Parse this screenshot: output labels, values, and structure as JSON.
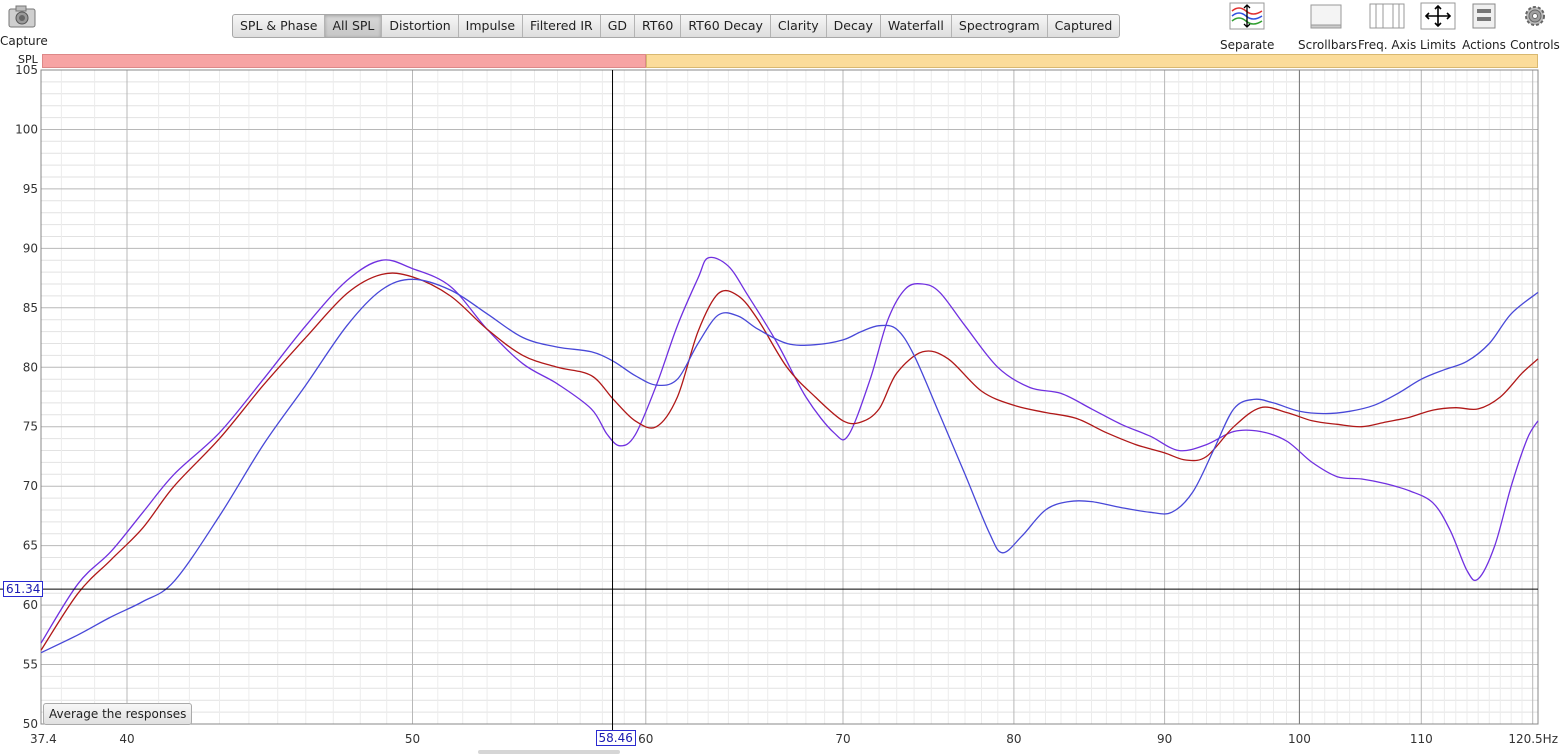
{
  "toolbar": {
    "capture_label": "Capture",
    "tabs": [
      {
        "label": "SPL & Phase",
        "active": false
      },
      {
        "label": "All SPL",
        "active": true
      },
      {
        "label": "Distortion",
        "active": false
      },
      {
        "label": "Impulse",
        "active": false
      },
      {
        "label": "Filtered IR",
        "active": false
      },
      {
        "label": "GD",
        "active": false
      },
      {
        "label": "RT60",
        "active": false
      },
      {
        "label": "RT60 Decay",
        "active": false
      },
      {
        "label": "Clarity",
        "active": false
      },
      {
        "label": "Decay",
        "active": false
      },
      {
        "label": "Waterfall",
        "active": false
      },
      {
        "label": "Spectrogram",
        "active": false
      },
      {
        "label": "Captured",
        "active": false
      }
    ],
    "tools": {
      "separate": "Separate",
      "scrollbars": "Scrollbars",
      "freq_axis": "Freq. Axis",
      "limits": "Limits",
      "actions": "Actions",
      "controls": "Controls"
    }
  },
  "legend_bar": {
    "label": "SPL",
    "colors": [
      "#f7a4a4",
      "#fbdc9a"
    ]
  },
  "cursor": {
    "x_value": "58.46",
    "y_value": "61.34"
  },
  "buttons": {
    "average": "Average the responses"
  },
  "chart_data": {
    "type": "line",
    "xscale": "log",
    "xlim": [
      37.4,
      120.5
    ],
    "ylim": [
      50,
      105
    ],
    "grid": true,
    "x_ticks": [
      "37.4",
      "40",
      "50",
      "60",
      "70",
      "80",
      "90",
      "100",
      "110",
      "120.5Hz"
    ],
    "x_tick_values": [
      37.4,
      40,
      50,
      60,
      70,
      80,
      90,
      100,
      110,
      120.5
    ],
    "y_ticks": [
      50,
      55,
      60,
      65,
      70,
      75,
      80,
      85,
      90,
      95,
      100,
      105
    ],
    "series": [
      {
        "color": "#7030e0",
        "points": [
          [
            37.4,
            56.8
          ],
          [
            38.5,
            61.8
          ],
          [
            39.5,
            64.5
          ],
          [
            40.5,
            67.8
          ],
          [
            41.5,
            71
          ],
          [
            43,
            74.5
          ],
          [
            44.5,
            79
          ],
          [
            46,
            83.5
          ],
          [
            47.5,
            87.3
          ],
          [
            48.8,
            89
          ],
          [
            50,
            88.3
          ],
          [
            51.5,
            86.8
          ],
          [
            53,
            83.2
          ],
          [
            54.5,
            80.3
          ],
          [
            56,
            78.6
          ],
          [
            57.5,
            76.5
          ],
          [
            58.2,
            74.4
          ],
          [
            58.8,
            73.4
          ],
          [
            59.5,
            74.3
          ],
          [
            60.5,
            78.5
          ],
          [
            61.5,
            83.5
          ],
          [
            62.5,
            87.5
          ],
          [
            63,
            89.2
          ],
          [
            64,
            88.5
          ],
          [
            65,
            86
          ],
          [
            66.5,
            82
          ],
          [
            68,
            77.5
          ],
          [
            69.5,
            74.5
          ],
          [
            70.3,
            74.3
          ],
          [
            71.5,
            79
          ],
          [
            72.5,
            84
          ],
          [
            73.5,
            86.6
          ],
          [
            74.5,
            87
          ],
          [
            75.5,
            86.3
          ],
          [
            77,
            83.5
          ],
          [
            79,
            80
          ],
          [
            81,
            78.3
          ],
          [
            83,
            77.8
          ],
          [
            85,
            76.5
          ],
          [
            87,
            75.2
          ],
          [
            89,
            74.2
          ],
          [
            91,
            73
          ],
          [
            93,
            73.5
          ],
          [
            95,
            74.6
          ],
          [
            97,
            74.6
          ],
          [
            99,
            73.8
          ],
          [
            101,
            72
          ],
          [
            103,
            70.8
          ],
          [
            105,
            70.6
          ],
          [
            107,
            70.2
          ],
          [
            109,
            69.6
          ],
          [
            111,
            68.6
          ],
          [
            112.5,
            66.3
          ],
          [
            114,
            62.9
          ],
          [
            115,
            62.2
          ],
          [
            116.5,
            65
          ],
          [
            118,
            70
          ],
          [
            119.5,
            74
          ],
          [
            120.5,
            75.5
          ]
        ]
      },
      {
        "color": "#b01818",
        "points": [
          [
            37.4,
            56.2
          ],
          [
            38.5,
            61
          ],
          [
            39.5,
            63.8
          ],
          [
            40.5,
            66.5
          ],
          [
            41.5,
            70
          ],
          [
            43,
            74
          ],
          [
            44.5,
            78.5
          ],
          [
            46,
            82.5
          ],
          [
            47.5,
            86.2
          ],
          [
            48.8,
            87.8
          ],
          [
            50,
            87.6
          ],
          [
            51.5,
            86
          ],
          [
            53,
            83.2
          ],
          [
            54.5,
            81
          ],
          [
            56,
            80
          ],
          [
            57.5,
            79.3
          ],
          [
            58.5,
            77.3
          ],
          [
            59.5,
            75.5
          ],
          [
            60.5,
            75
          ],
          [
            61.5,
            77.5
          ],
          [
            62.5,
            83
          ],
          [
            63.5,
            86.2
          ],
          [
            64.5,
            86
          ],
          [
            65.5,
            84
          ],
          [
            67,
            80
          ],
          [
            68.5,
            77.5
          ],
          [
            70,
            75.5
          ],
          [
            71,
            75.4
          ],
          [
            72,
            76.5
          ],
          [
            73,
            79.5
          ],
          [
            74.5,
            81.3
          ],
          [
            76,
            80.7
          ],
          [
            78,
            78
          ],
          [
            80,
            76.8
          ],
          [
            82,
            76.2
          ],
          [
            84,
            75.7
          ],
          [
            86,
            74.5
          ],
          [
            88,
            73.5
          ],
          [
            90,
            72.8
          ],
          [
            91.5,
            72.2
          ],
          [
            93,
            72.5
          ],
          [
            95,
            75
          ],
          [
            97,
            76.6
          ],
          [
            99,
            76.2
          ],
          [
            101,
            75.5
          ],
          [
            103,
            75.2
          ],
          [
            105,
            75
          ],
          [
            107,
            75.4
          ],
          [
            109,
            75.8
          ],
          [
            111,
            76.4
          ],
          [
            113,
            76.6
          ],
          [
            115,
            76.5
          ],
          [
            117,
            77.5
          ],
          [
            119,
            79.5
          ],
          [
            120.5,
            80.7
          ]
        ]
      },
      {
        "color": "#4848d8",
        "points": [
          [
            37.4,
            56
          ],
          [
            38.5,
            57.5
          ],
          [
            39.5,
            59
          ],
          [
            40.5,
            60.3
          ],
          [
            41.5,
            62
          ],
          [
            43,
            67.5
          ],
          [
            44.5,
            73.5
          ],
          [
            46,
            78.5
          ],
          [
            47.5,
            83.5
          ],
          [
            48.8,
            86.5
          ],
          [
            50,
            87.4
          ],
          [
            51.5,
            86.5
          ],
          [
            53,
            84.5
          ],
          [
            54.5,
            82.5
          ],
          [
            56,
            81.7
          ],
          [
            57.5,
            81.3
          ],
          [
            58.5,
            80.5
          ],
          [
            59.5,
            79.3
          ],
          [
            60.5,
            78.5
          ],
          [
            61.5,
            79
          ],
          [
            62.5,
            82
          ],
          [
            63.5,
            84.4
          ],
          [
            64.5,
            84.3
          ],
          [
            65.5,
            83.2
          ],
          [
            67,
            82
          ],
          [
            68.5,
            81.9
          ],
          [
            70,
            82.3
          ],
          [
            71,
            83
          ],
          [
            72,
            83.5
          ],
          [
            73,
            83.2
          ],
          [
            74,
            81
          ],
          [
            75.5,
            76
          ],
          [
            77,
            71
          ],
          [
            78.5,
            66
          ],
          [
            79.3,
            64.4
          ],
          [
            80.5,
            65.8
          ],
          [
            82,
            68
          ],
          [
            83.5,
            68.7
          ],
          [
            85,
            68.7
          ],
          [
            87,
            68.2
          ],
          [
            89,
            67.8
          ],
          [
            90.5,
            67.8
          ],
          [
            92,
            69.5
          ],
          [
            93.5,
            73
          ],
          [
            95,
            76.5
          ],
          [
            96.5,
            77.3
          ],
          [
            98,
            77
          ],
          [
            100,
            76.3
          ],
          [
            102,
            76.1
          ],
          [
            104,
            76.3
          ],
          [
            106,
            76.8
          ],
          [
            108,
            77.8
          ],
          [
            110,
            79
          ],
          [
            112,
            79.8
          ],
          [
            114,
            80.5
          ],
          [
            116,
            82
          ],
          [
            118,
            84.5
          ],
          [
            120.5,
            86.3
          ]
        ]
      }
    ]
  }
}
